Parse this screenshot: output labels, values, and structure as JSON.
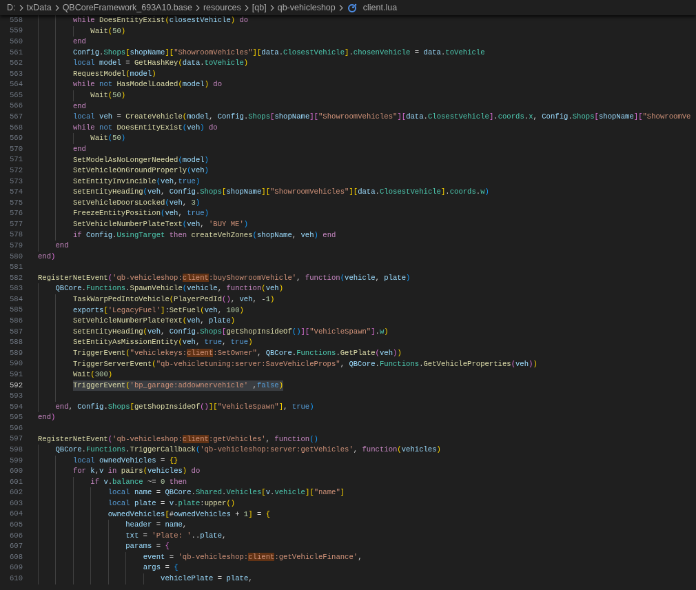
{
  "breadcrumb": [
    {
      "label": "D:",
      "kind": "folder"
    },
    {
      "label": "txData",
      "kind": "folder"
    },
    {
      "label": "QBCoreFramework_693A10.base",
      "kind": "folder"
    },
    {
      "label": "resources",
      "kind": "folder"
    },
    {
      "label": "[qb]",
      "kind": "folder"
    },
    {
      "label": "qb-vehicleshop",
      "kind": "folder"
    },
    {
      "label": "client.lua",
      "kind": "file"
    }
  ],
  "lines": [
    {
      "n": "558",
      "code": "        while DoesEntityExist(closestVehicle) do",
      "selected": false
    },
    {
      "n": "559",
      "code": "            Wait(50)",
      "selected": false
    },
    {
      "n": "560",
      "code": "        end",
      "selected": false
    },
    {
      "n": "561",
      "code": "        Config.Shops[shopName][\"ShowroomVehicles\"][data.ClosestVehicle].chosenVehicle = data.toVehicle",
      "selected": false
    },
    {
      "n": "562",
      "code": "        local model = GetHashKey(data.toVehicle)",
      "selected": false
    },
    {
      "n": "563",
      "code": "        RequestModel(model)",
      "selected": false
    },
    {
      "n": "564",
      "code": "        while not HasModelLoaded(model) do",
      "selected": false
    },
    {
      "n": "565",
      "code": "            Wait(50)",
      "selected": false
    },
    {
      "n": "566",
      "code": "        end",
      "selected": false
    },
    {
      "n": "567",
      "code": "        local veh = CreateVehicle(model, Config.Shops[shopName][\"ShowroomVehicles\"][data.ClosestVehicle].coords.x, Config.Shops[shopName][\"ShowroomVe",
      "selected": false
    },
    {
      "n": "568",
      "code": "        while not DoesEntityExist(veh) do",
      "selected": false
    },
    {
      "n": "569",
      "code": "            Wait(50)",
      "selected": false
    },
    {
      "n": "570",
      "code": "        end",
      "selected": false
    },
    {
      "n": "571",
      "code": "        SetModelAsNoLongerNeeded(model)",
      "selected": false
    },
    {
      "n": "572",
      "code": "        SetVehicleOnGroundProperly(veh)",
      "selected": false
    },
    {
      "n": "573",
      "code": "        SetEntityInvincible(veh,true)",
      "selected": false
    },
    {
      "n": "574",
      "code": "        SetEntityHeading(veh, Config.Shops[shopName][\"ShowroomVehicles\"][data.ClosestVehicle].coords.w)",
      "selected": false
    },
    {
      "n": "575",
      "code": "        SetVehicleDoorsLocked(veh, 3)",
      "selected": false
    },
    {
      "n": "576",
      "code": "        FreezeEntityPosition(veh, true)",
      "selected": false
    },
    {
      "n": "577",
      "code": "        SetVehicleNumberPlateText(veh, 'BUY ME')",
      "selected": false
    },
    {
      "n": "578",
      "code": "        if Config.UsingTarget then createVehZones(shopName, veh) end",
      "selected": false
    },
    {
      "n": "579",
      "code": "    end",
      "selected": false
    },
    {
      "n": "580",
      "code": "end)",
      "selected": false
    },
    {
      "n": "581",
      "selected": false
    },
    {
      "n": "582",
      "parts": [
        {
          "text": "RegisterNetEvent('qb-vehicleshop:",
          "match": false
        },
        {
          "text": "client",
          "match": true
        },
        {
          "text": ":buyShowroomVehicle', function(vehicle, plate)",
          "match": false
        }
      ],
      "selected": false
    },
    {
      "n": "583",
      "code": "    QBCore.Functions.SpawnVehicle(vehicle, function(veh)",
      "selected": false
    },
    {
      "n": "584",
      "code": "        TaskWarpPedIntoVehicle(PlayerPedId(), veh, -1)",
      "selected": false
    },
    {
      "n": "585",
      "code": "        exports['LegacyFuel']:SetFuel(veh, 100)",
      "selected": false
    },
    {
      "n": "586",
      "code": "        SetVehicleNumberPlateText(veh, plate)",
      "selected": false
    },
    {
      "n": "587",
      "code": "        SetEntityHeading(veh, Config.Shops[getShopInsideOf()][\"VehicleSpawn\"].w)",
      "selected": false
    },
    {
      "n": "588",
      "code": "        SetEntityAsMissionEntity(veh, true, true)",
      "selected": false
    },
    {
      "n": "589",
      "parts": [
        {
          "text": "        TriggerEvent(\"vehiclekeys:",
          "match": false
        },
        {
          "text": "client",
          "match": true
        },
        {
          "text": ":SetOwner\", QBCore.Functions.GetPlate(veh))",
          "match": false
        }
      ],
      "selected": false
    },
    {
      "n": "590",
      "code": "        TriggerServerEvent(\"qb-vehicletuning:server:SaveVehicleProps\", QBCore.Functions.GetVehicleProperties(veh))",
      "selected": false
    },
    {
      "n": "591",
      "code": "        Wait(300)",
      "selected": false
    },
    {
      "n": "592",
      "code": "        TriggerEvent('bp_garage:addownervehicle' ,false)",
      "selected": true
    },
    {
      "n": "593",
      "selected": false
    },
    {
      "n": "594",
      "code": "    end, Config.Shops[getShopInsideOf()][\"VehicleSpawn\"], true)",
      "selected": false
    },
    {
      "n": "595",
      "code": "end)",
      "selected": false
    },
    {
      "n": "596",
      "selected": false
    },
    {
      "n": "597",
      "parts": [
        {
          "text": "RegisterNetEvent('qb-vehicleshop:",
          "match": false
        },
        {
          "text": "client",
          "match": true
        },
        {
          "text": ":getVehicles', function()",
          "match": false
        }
      ],
      "selected": false
    },
    {
      "n": "598",
      "code": "    QBCore.Functions.TriggerCallback('qb-vehicleshop:server:getVehicles', function(vehicles)",
      "selected": false
    },
    {
      "n": "599",
      "code": "        local ownedVehicles = {}",
      "selected": false
    },
    {
      "n": "600",
      "code": "        for k,v in pairs(vehicles) do",
      "selected": false
    },
    {
      "n": "601",
      "code": "            if v.balance ~= 0 then",
      "selected": false
    },
    {
      "n": "602",
      "code": "                local name = QBCore.Shared.Vehicles[v.vehicle][\"name\"]",
      "selected": false
    },
    {
      "n": "603",
      "code": "                local plate = v.plate:upper()",
      "selected": false
    },
    {
      "n": "604",
      "code": "                ownedVehicles[#ownedVehicles + 1] = {",
      "selected": false
    },
    {
      "n": "605",
      "code": "                    header = name,",
      "selected": false
    },
    {
      "n": "606",
      "code": "                    txt = 'Plate: '..plate,",
      "selected": false
    },
    {
      "n": "607",
      "code": "                    params = {",
      "selected": false
    },
    {
      "n": "608",
      "parts": [
        {
          "text": "                        event = 'qb-vehicleshop:",
          "match": false
        },
        {
          "text": "client",
          "match": true
        },
        {
          "text": ":getVehicleFinance',",
          "match": false
        }
      ],
      "selected": false
    },
    {
      "n": "609",
      "code": "                        args = {",
      "selected": false
    },
    {
      "n": "610",
      "code": "                            vehiclePlate = plate,",
      "selected": false
    }
  ]
}
